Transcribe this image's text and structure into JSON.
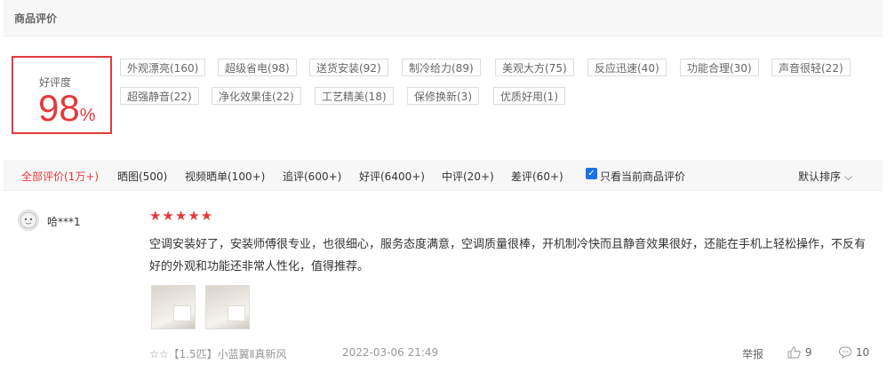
{
  "section": {
    "title": "商品评价"
  },
  "rating": {
    "label": "好评度",
    "value": "98",
    "unit": "%"
  },
  "tags": [
    "外观漂亮(160)",
    "超级省电(98)",
    "送货安装(92)",
    "制冷给力(89)",
    "美观大方(75)",
    "反应迅速(40)",
    "功能合理(30)",
    "声音很轻(22)",
    "超强静音(22)",
    "净化效果佳(22)",
    "工艺精美(18)",
    "保修换新(3)",
    "优质好用(1)"
  ],
  "filters": [
    "全部评价(1万+)",
    "晒图(500)",
    "视频晒单(100+)",
    "追评(600+)",
    "好评(6400+)",
    "中评(20+)",
    "差评(60+)"
  ],
  "only_current": "只看当前商品评价",
  "sort": "默认排序",
  "review": {
    "username": "哈***1",
    "stars": "★★★★★",
    "content": "空调安装好了，安装师傅很专业，也很细心，服务态度满意，空调质量很棒，开机制冷快而且静音效果很好，还能在手机上轻松操作，不反有好的外观和功能还非常人性化，值得推荐。",
    "product": "☆☆【1.5匹】小蓝翼Ⅱ真新风",
    "date": "2022-03-06 21:49",
    "report": "举报",
    "likes": "9",
    "comments": "10"
  },
  "colors": {
    "accent": "#e4393c",
    "checkbox": "#1a73e8"
  }
}
